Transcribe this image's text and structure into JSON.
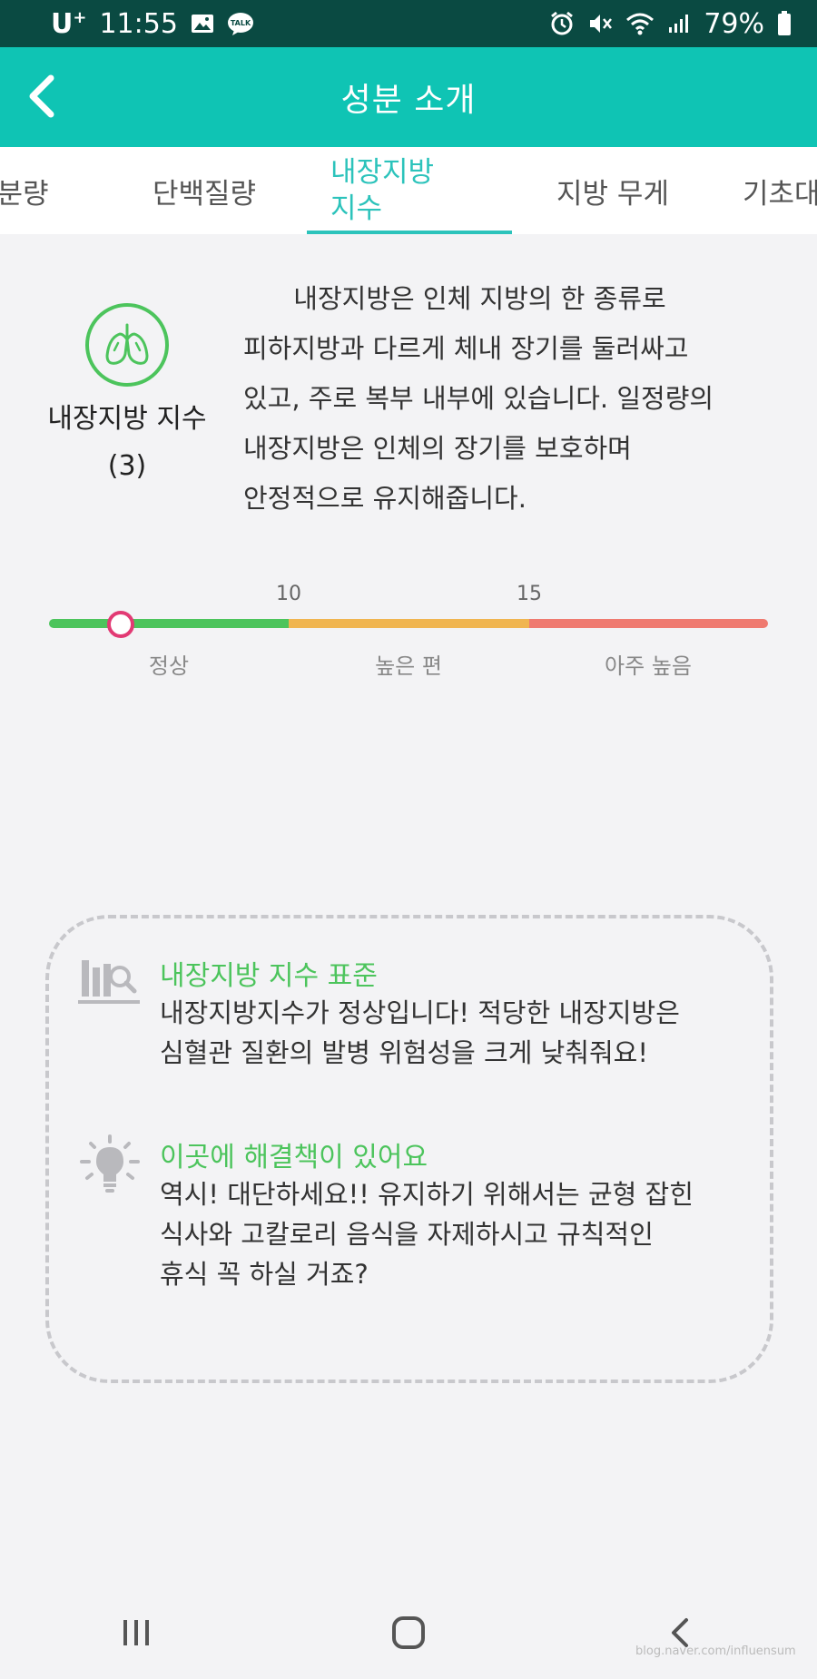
{
  "status_bar": {
    "carrier": "U",
    "carrier_sup": "+",
    "time": "11:55",
    "battery": "79%"
  },
  "app_bar": {
    "title": "성분 소개"
  },
  "tabs": [
    {
      "label": "분량",
      "active": false
    },
    {
      "label": "단백질량",
      "active": false
    },
    {
      "label": "내장지방\n지수",
      "active": true
    },
    {
      "label": "지방 무게",
      "active": false
    },
    {
      "label": "기초대",
      "active": false
    }
  ],
  "metric": {
    "label": "내장지방 지수",
    "value": "(3)",
    "icon": "lungs-icon",
    "accent": "#4cc45c"
  },
  "description": {
    "lines": [
      "      내장지방은 인체 지방의 한 종류로",
      "피하지방과 다르게 체내 장기를 둘러싸고",
      "있고, 주로 복부 내부에 있습니다. 일정량의",
      "내장지방은 인체의 장기를 보호하며",
      "안정적으로 유지해줍니다."
    ]
  },
  "scale": {
    "ticks": [
      "10",
      "15"
    ],
    "ranges": [
      {
        "label": "정상",
        "color": "#4cc45c"
      },
      {
        "label": "높은 편",
        "color": "#f0b550"
      },
      {
        "label": "아주 높음",
        "color": "#ef7a70"
      }
    ],
    "current_value": 3,
    "marker_color": "#e23a74"
  },
  "tips": [
    {
      "icon": "chart-search-icon",
      "title": "내장지방 지수 표준",
      "lines": [
        "내장지방지수가 정상입니다! 적당한 내장지방은",
        "심혈관 질환의 발병 위험성을 크게 낮춰줘요!"
      ]
    },
    {
      "icon": "lightbulb-icon",
      "title": "이곳에 해결책이 있어요",
      "lines": [
        "역시! 대단하세요!! 유지하기 위해서는 균형 잡힌",
        "식사와 고칼로리 음식을 자제하시고 규칙적인",
        "휴식 꼭 하실 거죠?"
      ]
    }
  ],
  "colors": {
    "status_bar": "#0a4a42",
    "app_bar": "#0fc4b4",
    "tab_active": "#2cc3bb",
    "background": "#f3f3f5"
  },
  "watermark": "blog.naver.com/influensum"
}
